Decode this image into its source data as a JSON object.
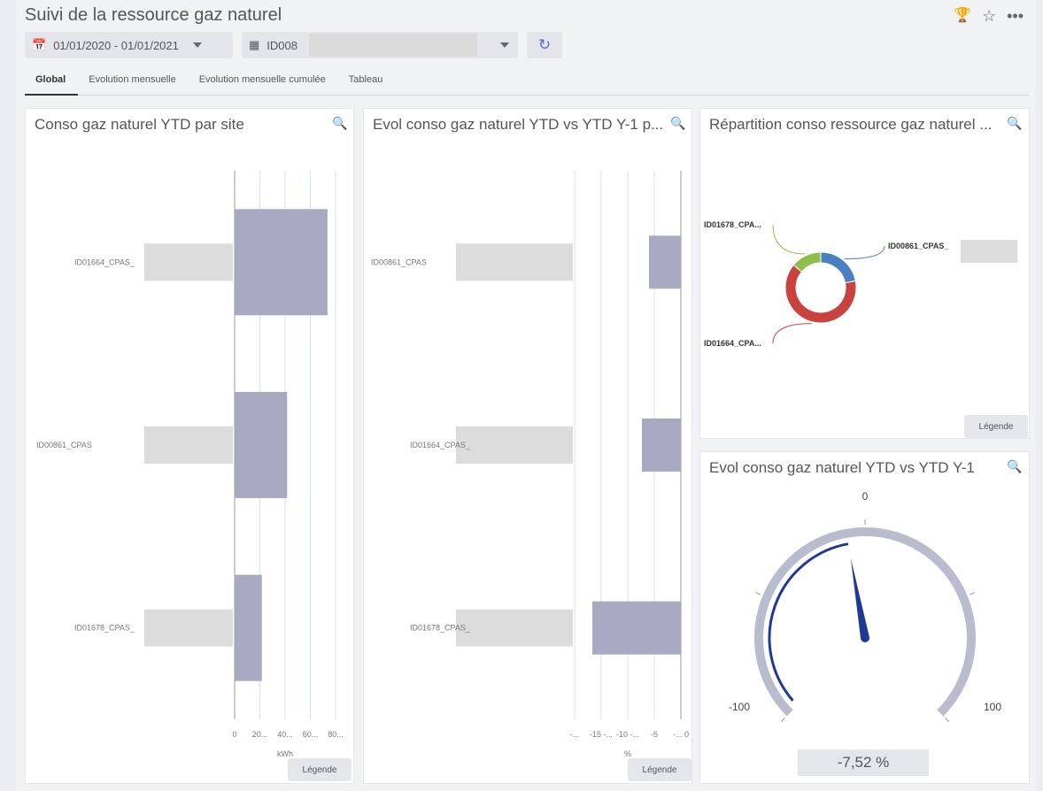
{
  "header": {
    "title": "Suivi de la ressource gaz naturel",
    "date_range": "01/01/2020 - 01/01/2021",
    "site_value": "ID008",
    "icons": [
      "trophy-icon",
      "star-icon",
      "more-icon",
      "calendar-icon",
      "building-icon",
      "refresh-icon"
    ]
  },
  "tabs": [
    {
      "label": "Global",
      "active": true
    },
    {
      "label": "Evolution mensuelle",
      "active": false
    },
    {
      "label": "Evolution mensuelle cumulée",
      "active": false
    },
    {
      "label": "Tableau",
      "active": false
    }
  ],
  "panels": {
    "p1": {
      "title": "Conso gaz naturel YTD par site",
      "legend_label": "Légende"
    },
    "p2": {
      "title": "Evol conso gaz naturel YTD vs YTD Y-1 p...",
      "legend_label": "Légende"
    },
    "p3": {
      "title": "Répartition conso ressource gaz naturel ...",
      "legend_label": "Légende"
    },
    "p4": {
      "title": "Evol conso gaz naturel YTD vs YTD Y-1",
      "kpi_value": "-7,52 %"
    }
  },
  "chart_data": [
    {
      "type": "bar",
      "orientation": "horizontal",
      "categories": [
        "ID01664_CPAS_",
        "ID00861_CPAS",
        "ID01678_CPAS_"
      ],
      "values": [
        92,
        52,
        27
      ],
      "xlabel": "kWh",
      "xticks": [
        "0",
        "20...",
        "40...",
        "60...",
        "80..."
      ],
      "xlim": [
        0,
        100
      ],
      "color": "#a9a9c2"
    },
    {
      "type": "bar",
      "orientation": "horizontal",
      "categories": [
        "ID00861_CPAS",
        "ID01664_CPAS_",
        "ID01678_CPAS_"
      ],
      "values": [
        -4.5,
        -5.5,
        -12.5
      ],
      "xlabel": "%",
      "xticks": [
        "-...",
        "-15 -...",
        "-10 -...",
        "-5",
        "-... 0"
      ],
      "xlim": [
        -15,
        0
      ],
      "color": "#a9a9c2"
    },
    {
      "type": "pie",
      "donut": true,
      "labels": [
        "ID00861_CPAS_",
        "ID01664_CPA...",
        "ID01678_CPA..."
      ],
      "values": [
        22,
        64,
        14
      ],
      "colors": [
        "#4a7fc1",
        "#c9423e",
        "#8fbe4c"
      ]
    },
    {
      "type": "gauge",
      "min": -100,
      "max": 100,
      "value": -7.52,
      "ticks": [
        "-100",
        "0",
        "100"
      ]
    }
  ]
}
